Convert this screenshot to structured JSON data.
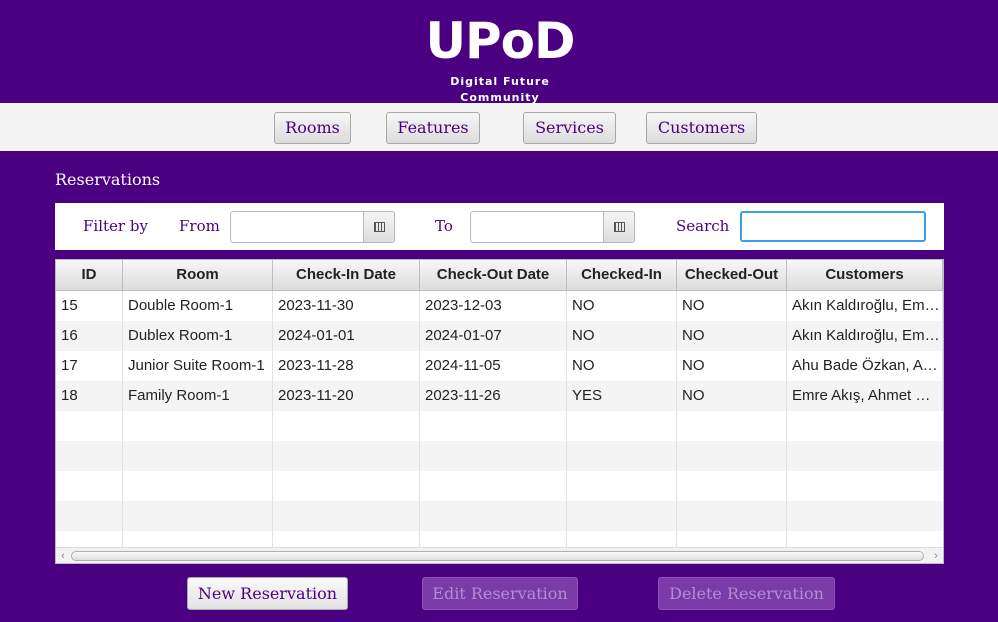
{
  "brand": {
    "logo": "UPoD",
    "tagline": "Digital Future Community"
  },
  "nav": {
    "items": [
      {
        "label": "Rooms"
      },
      {
        "label": "Features"
      },
      {
        "label": "Services"
      },
      {
        "label": "Customers"
      }
    ]
  },
  "section": {
    "title": "Reservations"
  },
  "filters": {
    "filter_by": "Filter by",
    "from_label": "From",
    "to_label": "To",
    "search_label": "Search",
    "from_value": "",
    "to_value": "",
    "search_value": ""
  },
  "table": {
    "headers": [
      "ID",
      "Room",
      "Check-In Date",
      "Check-Out Date",
      "Checked-In",
      "Checked-Out",
      "Customers"
    ],
    "rows": [
      [
        "15",
        "Double Room-1",
        "2023-11-30",
        "2023-12-03",
        "NO",
        "NO",
        "Akın Kaldıroğlu, Emre..."
      ],
      [
        "16",
        "Dublex Room-1",
        "2024-01-01",
        "2024-01-07",
        "NO",
        "NO",
        "Akın Kaldıroğlu, Emre..."
      ],
      [
        "17",
        "Junior Suite Room-1",
        "2023-11-28",
        "2024-11-05",
        "NO",
        "NO",
        "Ahu Bade Özkan, Ayş..."
      ],
      [
        "18",
        "Family Room-1",
        "2023-11-20",
        "2023-11-26",
        "YES",
        "NO",
        "Emre Akış, Ahmet Gül..."
      ]
    ]
  },
  "actions": {
    "new_label": "New Reservation",
    "edit_label": "Edit Reservation",
    "delete_label": "Delete Reservation"
  },
  "colors": {
    "brand_purple": "#4b0082",
    "focus_blue": "#39a0e8"
  }
}
